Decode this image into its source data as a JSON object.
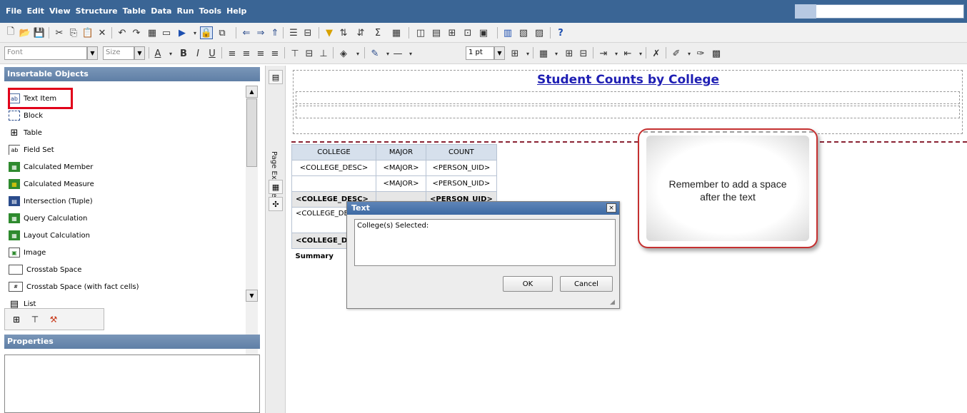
{
  "menu": {
    "items": [
      "File",
      "Edit",
      "View",
      "Structure",
      "Table",
      "Data",
      "Run",
      "Tools",
      "Help"
    ]
  },
  "toolbar2": {
    "font_placeholder": "Font",
    "size_placeholder": "Size",
    "line_width": "1 pt",
    "bold_label": "B",
    "italic_label": "I",
    "underline_label": "U",
    "help_label": "?"
  },
  "left_panel": {
    "insertable_header": "Insertable Objects",
    "properties_header": "Properties",
    "items": [
      {
        "label": "Text Item",
        "icon": "text-item-icon"
      },
      {
        "label": "Block",
        "icon": "block-icon"
      },
      {
        "label": "Table",
        "icon": "table-icon"
      },
      {
        "label": "Field Set",
        "icon": "field-set-icon"
      },
      {
        "label": "Calculated Member",
        "icon": "calculated-member-icon"
      },
      {
        "label": "Calculated Measure",
        "icon": "calculated-measure-icon"
      },
      {
        "label": "Intersection (Tuple)",
        "icon": "intersection-icon"
      },
      {
        "label": "Query Calculation",
        "icon": "query-calculation-icon"
      },
      {
        "label": "Layout Calculation",
        "icon": "layout-calculation-icon"
      },
      {
        "label": "Image",
        "icon": "image-icon"
      },
      {
        "label": "Crosstab Space",
        "icon": "crosstab-space-icon"
      },
      {
        "label": "Crosstab Space (with fact cells)",
        "icon": "crosstab-space-fact-icon"
      },
      {
        "label": "List",
        "icon": "list-icon"
      }
    ],
    "text_item_icon_text": "ab",
    "field_set_icon_text": "ab"
  },
  "page_explorer": {
    "label": "Page Explorer"
  },
  "canvas": {
    "report_title": "Student Counts by College",
    "crosstab": {
      "headers": [
        "COLLEGE",
        "MAJOR",
        "COUNT"
      ],
      "row1": [
        "<COLLEGE_DESC>",
        "<MAJOR>",
        "<PERSON_UID>"
      ],
      "row2": [
        "",
        "<MAJOR>",
        "<PERSON_UID>"
      ],
      "row3": [
        "<COLLEGE_DESC>",
        "",
        "<PERSON_UID>"
      ],
      "row4": [
        "<COLLEGE_DE",
        ""
      ],
      "row5": [
        "<COLLEGE_D"
      ],
      "row6": [
        "Summary"
      ]
    }
  },
  "dialog": {
    "title": "Text",
    "close_label": "×",
    "text_value": "College(s) Selected:",
    "ok_label": "OK",
    "cancel_label": "Cancel"
  },
  "callout": {
    "line1": "Remember to add a space",
    "line2": "after the text"
  },
  "colors": {
    "menubar": "#3a6595",
    "title_link": "#1f1fb3",
    "highlight_red": "#e1001a"
  }
}
